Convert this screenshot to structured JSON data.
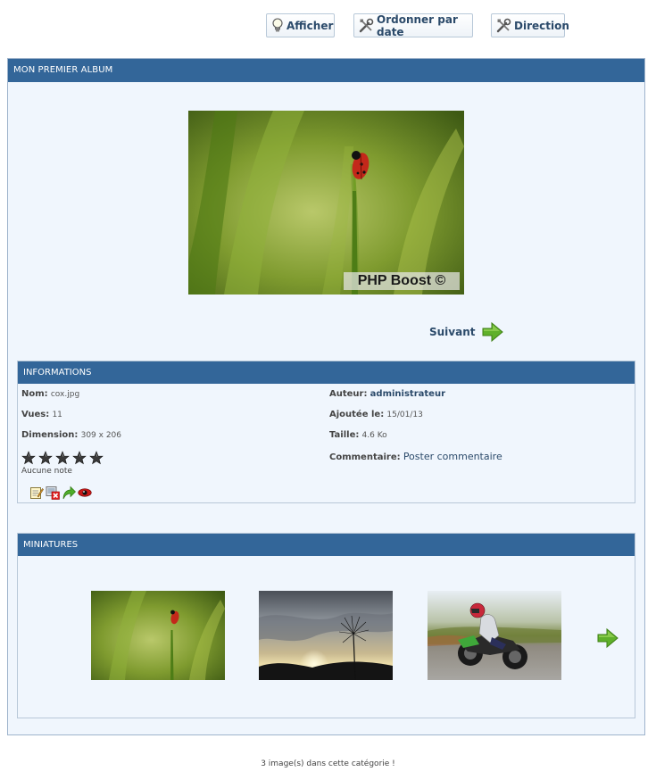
{
  "toolbar": {
    "show_label": "Afficher",
    "order_label": "Ordonner par date",
    "direction_label": "Direction"
  },
  "album": {
    "title": "MON PREMIER ALBUM",
    "watermark": "PHP Boost ©",
    "next_label": "Suivant"
  },
  "info": {
    "title": "INFORMATIONS",
    "name_label": "Nom:",
    "name_value": "cox.jpg",
    "views_label": "Vues:",
    "views_value": "11",
    "dim_label": "Dimension:",
    "dim_value": "309 x 206",
    "rating_note": "Aucune note",
    "author_label": "Auteur:",
    "author_value": "administrateur",
    "added_label": "Ajoutée le:",
    "added_value": "15/01/13",
    "size_label": "Taille:",
    "size_value": "4.6 Ko",
    "comment_label": "Commentaire:",
    "comment_link": "Poster commentaire",
    "rating_stars": 0,
    "rating_max": 5,
    "icons": [
      "edit-icon",
      "delete-icon",
      "move-icon",
      "hide-icon"
    ]
  },
  "miniatures": {
    "title": "MINIATURES",
    "items": [
      {
        "icon": "ladybug-thumbnail"
      },
      {
        "icon": "dandelion-sunset-thumbnail"
      },
      {
        "icon": "motorcycle-thumbnail"
      }
    ]
  },
  "footer": {
    "count_text": "3 image(s) dans cette catégorie !"
  },
  "colors": {
    "header_bar": "#336699",
    "panel_bg": "#f0f6fd",
    "link": "#2b4a6a",
    "arrow_green": "#5fb02a"
  }
}
